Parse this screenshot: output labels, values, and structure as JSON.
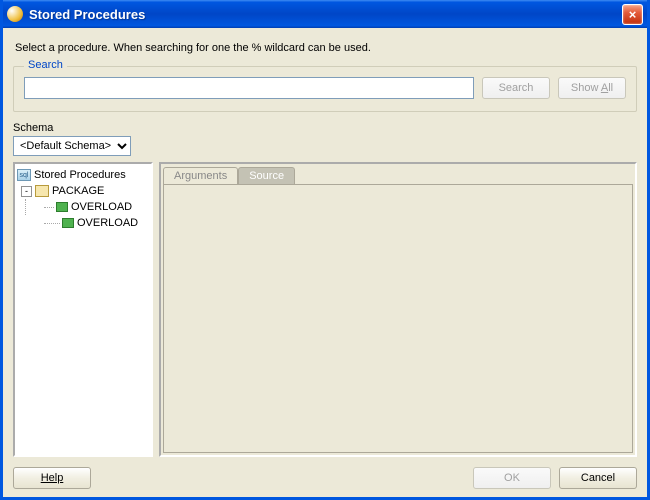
{
  "window": {
    "title": "Stored Procedures"
  },
  "instruction": "Select a procedure. When searching for one the % wildcard can be used.",
  "search": {
    "legend": "Search",
    "value": "",
    "placeholder": "",
    "search_btn": "Search",
    "show_all_btn": "Show All"
  },
  "schema": {
    "label": "Schema",
    "selected": "<Default Schema>",
    "options": [
      "<Default Schema>"
    ]
  },
  "tree": {
    "root": "Stored Procedures",
    "nodes": [
      {
        "label": "PACKAGE",
        "children": [
          {
            "label": "OVERLOAD"
          },
          {
            "label": "OVERLOAD"
          }
        ]
      }
    ]
  },
  "tabs": {
    "items": [
      {
        "label": "Arguments",
        "active": false
      },
      {
        "label": "Source",
        "active": true
      }
    ]
  },
  "buttons": {
    "help": "Help",
    "ok": "OK",
    "cancel": "Cancel"
  }
}
